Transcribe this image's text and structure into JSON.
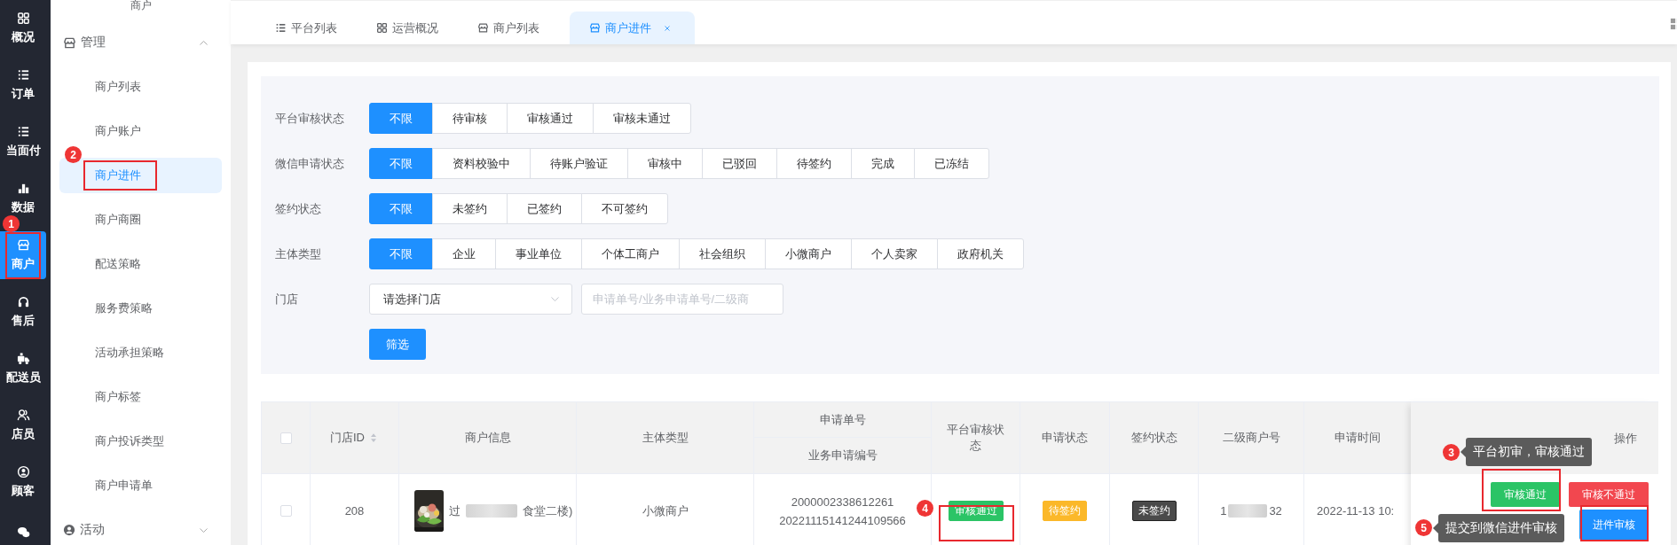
{
  "nav_rail": {
    "items": [
      {
        "label": "概况",
        "selected": false
      },
      {
        "label": "订单",
        "selected": false
      },
      {
        "label": "当面付",
        "selected": false
      },
      {
        "label": "数据",
        "selected": false
      },
      {
        "label": "商户",
        "selected": true
      },
      {
        "label": "售后",
        "selected": false
      },
      {
        "label": "配送员",
        "selected": false
      },
      {
        "label": "店员",
        "selected": false
      },
      {
        "label": "顾客",
        "selected": false
      }
    ]
  },
  "submenu": {
    "header": "商户",
    "groups": [
      {
        "label": "管理",
        "expanded": true,
        "children": [
          {
            "label": "商户列表",
            "selected": false
          },
          {
            "label": "商户账户",
            "selected": false
          },
          {
            "label": "商户进件",
            "selected": true
          },
          {
            "label": "商户商圈",
            "selected": false
          },
          {
            "label": "配送策略",
            "selected": false
          },
          {
            "label": "服务费策略",
            "selected": false
          },
          {
            "label": "活动承担策略",
            "selected": false
          },
          {
            "label": "商户标签",
            "selected": false
          },
          {
            "label": "商户投诉类型",
            "selected": false
          },
          {
            "label": "商户申请单",
            "selected": false
          }
        ]
      },
      {
        "label": "活动",
        "expanded": false
      }
    ]
  },
  "tabs": [
    {
      "label": "平台列表",
      "selected": false,
      "closable": false
    },
    {
      "label": "运营概况",
      "selected": false,
      "closable": false
    },
    {
      "label": "商户列表",
      "selected": false,
      "closable": false
    },
    {
      "label": "商户进件",
      "selected": true,
      "closable": true
    }
  ],
  "filters": [
    {
      "kind": "segmented",
      "label": "平台审核状态",
      "options": [
        {
          "label": "不限",
          "selected": true
        },
        {
          "label": "待审核",
          "selected": false
        },
        {
          "label": "审核通过",
          "selected": false
        },
        {
          "label": "审核未通过",
          "selected": false
        }
      ]
    },
    {
      "kind": "segmented",
      "label": "微信申请状态",
      "options": [
        {
          "label": "不限",
          "selected": true
        },
        {
          "label": "资料校验中",
          "selected": false
        },
        {
          "label": "待账户验证",
          "selected": false
        },
        {
          "label": "审核中",
          "selected": false
        },
        {
          "label": "已驳回",
          "selected": false
        },
        {
          "label": "待签约",
          "selected": false
        },
        {
          "label": "完成",
          "selected": false
        },
        {
          "label": "已冻结",
          "selected": false
        }
      ]
    },
    {
      "kind": "segmented",
      "label": "签约状态",
      "options": [
        {
          "label": "不限",
          "selected": true
        },
        {
          "label": "未签约",
          "selected": false
        },
        {
          "label": "已签约",
          "selected": false
        },
        {
          "label": "不可签约",
          "selected": false
        }
      ]
    },
    {
      "kind": "segmented",
      "label": "主体类型",
      "options": [
        {
          "label": "不限",
          "selected": true
        },
        {
          "label": "企业",
          "selected": false
        },
        {
          "label": "事业单位",
          "selected": false
        },
        {
          "label": "个体工商户",
          "selected": false
        },
        {
          "label": "社会组织",
          "selected": false
        },
        {
          "label": "小微商户",
          "selected": false
        },
        {
          "label": "个人卖家",
          "selected": false
        },
        {
          "label": "政府机关",
          "selected": false
        }
      ]
    },
    {
      "kind": "fields",
      "label": "门店",
      "select": {
        "value": "请选择门店"
      },
      "input": {
        "placeholder": "申请单号/业务申请单号/二级商"
      }
    }
  ],
  "filter_button": "筛选",
  "table": {
    "all_checked": false,
    "columns": [
      {
        "label": "门店ID",
        "sortable": true
      },
      {
        "label": "商户信息"
      },
      {
        "label": "主体类型"
      },
      {
        "label": "申请单号",
        "sub_label": "业务申请编号"
      },
      {
        "label": "平台审核状态"
      },
      {
        "label": "申请状态"
      },
      {
        "label": "签约状态"
      },
      {
        "label": "二级商户号"
      },
      {
        "label": "申请时间"
      },
      {
        "label": "操作"
      }
    ],
    "rows": [
      {
        "checked": false,
        "store_id": "208",
        "merchant_name_start": "过",
        "merchant_name_end": "食堂二楼)",
        "entity_type": "小微商户",
        "application_no": "2000002338612261",
        "business_no": "20221115141244109566",
        "platform_status": {
          "label": "审核通过",
          "kind": "success"
        },
        "apply_status": {
          "label": "待签约",
          "kind": "warning"
        },
        "sign_status": {
          "label": "未签约",
          "kind": "dark"
        },
        "sub_merchant_start": "1",
        "sub_merchant_end": "32",
        "apply_time": "2022-11-13 10:",
        "actions": [
          {
            "label": "审核通过",
            "kind": "success"
          },
          {
            "label": "审核不通过",
            "kind": "danger"
          },
          {
            "label": "进件审核",
            "kind": "primary"
          }
        ]
      }
    ]
  },
  "annotations": [
    {
      "number": "1"
    },
    {
      "number": "2"
    },
    {
      "number": "3",
      "tooltip": "平台初审，审核通过"
    },
    {
      "number": "4"
    },
    {
      "number": "5",
      "tooltip": "提交到微信进件审核"
    }
  ]
}
